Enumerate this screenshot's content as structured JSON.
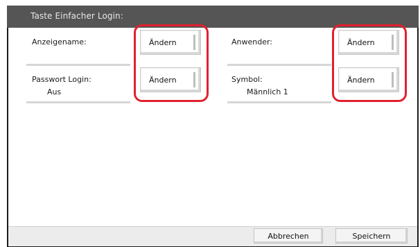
{
  "dialog": {
    "title": "Taste Einfacher Login:"
  },
  "fields": {
    "display_name": {
      "label": "Anzeigename:",
      "value": "",
      "button": "Ändern"
    },
    "password_login": {
      "label": "Passwort Login:",
      "value": "Aus",
      "button": "Ändern"
    },
    "user": {
      "label": "Anwender:",
      "value": "",
      "button": "Ändern"
    },
    "symbol": {
      "label": "Symbol:",
      "value": "Männlich 1",
      "button": "Ändern"
    }
  },
  "footer": {
    "cancel_label": "Abbrechen",
    "save_label": "Speichern"
  },
  "colors": {
    "highlight": "#e0202e",
    "title_bar": "#555555"
  }
}
